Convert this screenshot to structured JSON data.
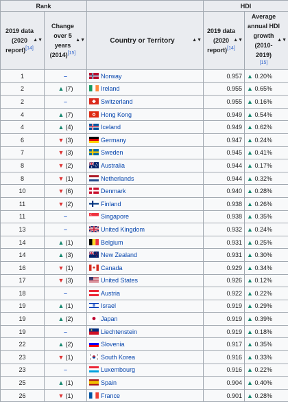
{
  "header": {
    "rank_group": "Rank",
    "hdi_group": "HDI",
    "col_rank_2019": [
      "2019 data",
      "(2020",
      "report)"
    ],
    "col_rank_2019_ref": "[14]",
    "col_change": [
      "Change",
      "over 5 years",
      "(2014)"
    ],
    "col_change_ref": "[15]",
    "col_country": "Country or Territory",
    "col_hdi_2019": [
      "2019 data",
      "(2020",
      "report)"
    ],
    "col_hdi_2019_ref": "[14]",
    "col_growth": [
      "Average",
      "annual HDI",
      "growth",
      "(2010-2019)"
    ],
    "col_growth_ref": "[15]",
    "sort_icon": "▲▼"
  },
  "colors": {
    "up": "#14866d",
    "down": "#dd3333",
    "same": "#3366cc",
    "link": "#0645ad"
  },
  "rows": [
    {
      "rank": "1",
      "dir": "same",
      "change": "",
      "country": "Norway",
      "flag": "norway",
      "hdi": "0.957",
      "growth": "0.20%"
    },
    {
      "rank": "2",
      "dir": "up",
      "change": "(7)",
      "country": "Ireland",
      "flag": "ireland",
      "hdi": "0.955",
      "growth": "0.65%"
    },
    {
      "rank": "2",
      "dir": "same",
      "change": "",
      "country": "Switzerland",
      "flag": "switzerland",
      "hdi": "0.955",
      "growth": "0.16%"
    },
    {
      "rank": "4",
      "dir": "up",
      "change": "(7)",
      "country": "Hong Kong",
      "flag": "hongkong",
      "hdi": "0.949",
      "growth": "0.54%"
    },
    {
      "rank": "4",
      "dir": "up",
      "change": "(4)",
      "country": "Iceland",
      "flag": "iceland",
      "hdi": "0.949",
      "growth": "0.62%"
    },
    {
      "rank": "6",
      "dir": "down",
      "change": "(3)",
      "country": "Germany",
      "flag": "germany",
      "hdi": "0.947",
      "growth": "0.24%"
    },
    {
      "rank": "7",
      "dir": "down",
      "change": "(3)",
      "country": "Sweden",
      "flag": "sweden",
      "hdi": "0.945",
      "growth": "0.41%"
    },
    {
      "rank": "8",
      "dir": "down",
      "change": "(2)",
      "country": "Australia",
      "flag": "australia",
      "hdi": "0.944",
      "growth": "0.17%"
    },
    {
      "rank": "8",
      "dir": "down",
      "change": "(1)",
      "country": "Netherlands",
      "flag": "netherlands",
      "hdi": "0.944",
      "growth": "0.32%"
    },
    {
      "rank": "10",
      "dir": "down",
      "change": "(6)",
      "country": "Denmark",
      "flag": "denmark",
      "hdi": "0.940",
      "growth": "0.28%"
    },
    {
      "rank": "11",
      "dir": "down",
      "change": "(2)",
      "country": "Finland",
      "flag": "finland",
      "hdi": "0.938",
      "growth": "0.26%"
    },
    {
      "rank": "11",
      "dir": "same",
      "change": "",
      "country": "Singapore",
      "flag": "singapore",
      "hdi": "0.938",
      "growth": "0.35%"
    },
    {
      "rank": "13",
      "dir": "same",
      "change": "",
      "country": "United Kingdom",
      "flag": "uk",
      "hdi": "0.932",
      "growth": "0.24%"
    },
    {
      "rank": "14",
      "dir": "up",
      "change": "(1)",
      "country": "Belgium",
      "flag": "belgium",
      "hdi": "0.931",
      "growth": "0.25%"
    },
    {
      "rank": "14",
      "dir": "up",
      "change": "(3)",
      "country": "New Zealand",
      "flag": "newzealand",
      "hdi": "0.931",
      "growth": "0.30%"
    },
    {
      "rank": "16",
      "dir": "down",
      "change": "(1)",
      "country": "Canada",
      "flag": "canada",
      "hdi": "0.929",
      "growth": "0.34%"
    },
    {
      "rank": "17",
      "dir": "down",
      "change": "(3)",
      "country": "United States",
      "flag": "us",
      "hdi": "0.926",
      "growth": "0.12%"
    },
    {
      "rank": "18",
      "dir": "same",
      "change": "",
      "country": "Austria",
      "flag": "austria",
      "hdi": "0.922",
      "growth": "0.22%"
    },
    {
      "rank": "19",
      "dir": "up",
      "change": "(1)",
      "country": "Israel",
      "flag": "israel",
      "hdi": "0.919",
      "growth": "0.29%"
    },
    {
      "rank": "19",
      "dir": "up",
      "change": "(2)",
      "country": "Japan",
      "flag": "japan",
      "hdi": "0.919",
      "growth": "0.39%"
    },
    {
      "rank": "19",
      "dir": "same",
      "change": "",
      "country": "Liechtenstein",
      "flag": "liechtenstein",
      "hdi": "0.919",
      "growth": "0.18%"
    },
    {
      "rank": "22",
      "dir": "up",
      "change": "(2)",
      "country": "Slovenia",
      "flag": "slovenia",
      "hdi": "0.917",
      "growth": "0.35%"
    },
    {
      "rank": "23",
      "dir": "down",
      "change": "(1)",
      "country": "South Korea",
      "flag": "southkorea",
      "hdi": "0.916",
      "growth": "0.33%"
    },
    {
      "rank": "23",
      "dir": "same",
      "change": "",
      "country": "Luxembourg",
      "flag": "luxembourg",
      "hdi": "0.916",
      "growth": "0.22%"
    },
    {
      "rank": "25",
      "dir": "up",
      "change": "(1)",
      "country": "Spain",
      "flag": "spain",
      "hdi": "0.904",
      "growth": "0.40%"
    },
    {
      "rank": "26",
      "dir": "down",
      "change": "(1)",
      "country": "France",
      "flag": "france",
      "hdi": "0.901",
      "growth": "0.28%"
    }
  ]
}
